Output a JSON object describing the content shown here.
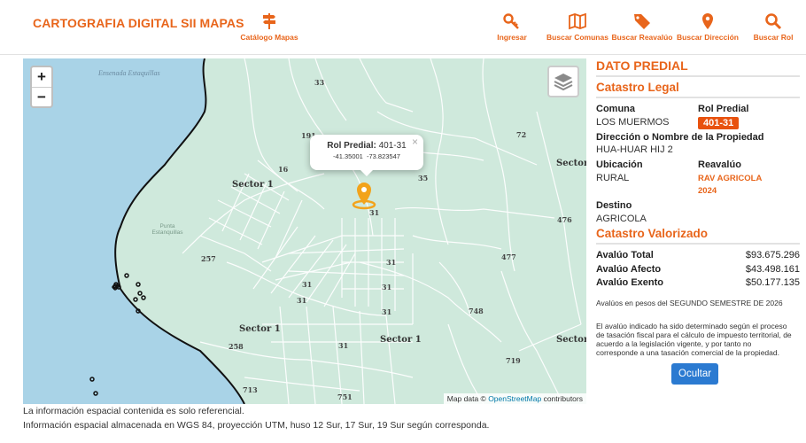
{
  "header": {
    "brand": "CARTOGRAFIA DIGITAL SII MAPAS",
    "nav": [
      {
        "label": "Catálogo Mapas",
        "icon": "signpost-icon"
      },
      {
        "label": "Ingresar",
        "icon": "key-icon"
      },
      {
        "label": "Buscar Comunas",
        "icon": "map-icon"
      },
      {
        "label": "Buscar Reavalúo",
        "icon": "tag-icon"
      },
      {
        "label": "Buscar Dirección",
        "icon": "map-pin-icon"
      },
      {
        "label": "Buscar Rol",
        "icon": "search-icon"
      }
    ]
  },
  "map": {
    "zoom_in": "+",
    "zoom_out": "−",
    "popup": {
      "label": "Rol Predial:",
      "value": "401-31",
      "lat": "-41.35001",
      "lon": "-73.823547",
      "close": "×"
    },
    "attribution_prefix": "Map data ©",
    "attribution_link": "OpenStreetMap",
    "attribution_suffix": "contributors",
    "water_labels": [
      {
        "text": "Ensenada Estaquillas"
      }
    ],
    "punta_label": "Punta Estanquillas",
    "lot_numbers": [
      "33",
      "191",
      "16",
      "35",
      "72",
      "31",
      "476",
      "257",
      "477",
      "31",
      "31",
      "31",
      "31",
      "31",
      "748",
      "258",
      "719",
      "713",
      "751",
      "31"
    ],
    "sectors": [
      "Sector 1",
      "Sector 1",
      "Sector 1",
      "Sector",
      "Sector"
    ],
    "colors": {
      "sea": "#a9d3e7",
      "land": "#cfe9dc",
      "lines": "#ffffff",
      "marker": "#f2a31b"
    }
  },
  "panel": {
    "title": "DATO PREDIAL",
    "legal": {
      "title": "Catastro Legal",
      "comuna_label": "Comuna",
      "comuna_value": "LOS MUERMOS",
      "rol_label": "Rol Predial",
      "rol_value": "401-31",
      "direccion_label": "Dirección o Nombre de la Propiedad",
      "direccion_value": "HUA-HUAR HIJ 2",
      "ubicacion_label": "Ubicación",
      "ubicacion_value": "RURAL",
      "reavaluo_label": "Reavalúo",
      "reavaluo_value_1": "RAV AGRICOLA",
      "reavaluo_value_2": "2024",
      "destino_label": "Destino",
      "destino_value": "AGRICOLA"
    },
    "valorizado": {
      "title": "Catastro Valorizado",
      "rows": [
        {
          "label": "Avalúo Total",
          "value": "$93.675.296"
        },
        {
          "label": "Avalúo Afecto",
          "value": "$43.498.161"
        },
        {
          "label": "Avalúo Exento",
          "value": "$50.177.135"
        }
      ],
      "note1": "Avalúos en pesos del SEGUNDO SEMESTRE DE 2026",
      "note2": "El avalúo indicado ha sido determinado según el proceso de tasación fiscal para el cálculo de impuesto territorial, de acuerdo a la legislación vigente, y por tanto no corresponde a una tasación comercial de la propiedad.",
      "hide_button": "Ocultar"
    }
  },
  "footer": {
    "line1": "La información espacial contenida es solo referencial.",
    "line2": "Información espacial almacenada en WGS 84, proyección UTM, huso 12 Sur, 17 Sur, 19 Sur según corresponda."
  }
}
